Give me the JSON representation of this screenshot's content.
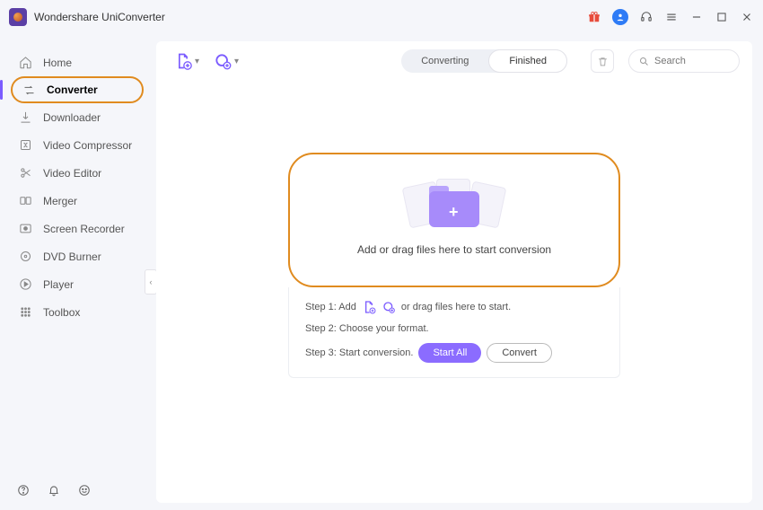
{
  "title": "Wondershare UniConverter",
  "sidebar": {
    "items": [
      {
        "label": "Home",
        "icon": "home"
      },
      {
        "label": "Converter",
        "icon": "converter"
      },
      {
        "label": "Downloader",
        "icon": "download"
      },
      {
        "label": "Video Compressor",
        "icon": "compress"
      },
      {
        "label": "Video Editor",
        "icon": "scissors"
      },
      {
        "label": "Merger",
        "icon": "merge"
      },
      {
        "label": "Screen Recorder",
        "icon": "record"
      },
      {
        "label": "DVD Burner",
        "icon": "disc"
      },
      {
        "label": "Player",
        "icon": "play"
      },
      {
        "label": "Toolbox",
        "icon": "grid"
      }
    ],
    "activeIndex": 1
  },
  "toolbar": {
    "tabs": {
      "converting": "Converting",
      "finished": "Finished",
      "active": "finished"
    },
    "search_placeholder": "Search"
  },
  "dropzone": {
    "text": "Add or drag files here to start conversion"
  },
  "steps": {
    "s1a": "Step 1: Add",
    "s1b": "or drag files here to start.",
    "s2": "Step 2: Choose your format.",
    "s3": "Step 3: Start conversion.",
    "start_all": "Start All",
    "convert": "Convert"
  },
  "colors": {
    "accent": "#7b5cff",
    "highlight_border": "#e08b1f"
  }
}
